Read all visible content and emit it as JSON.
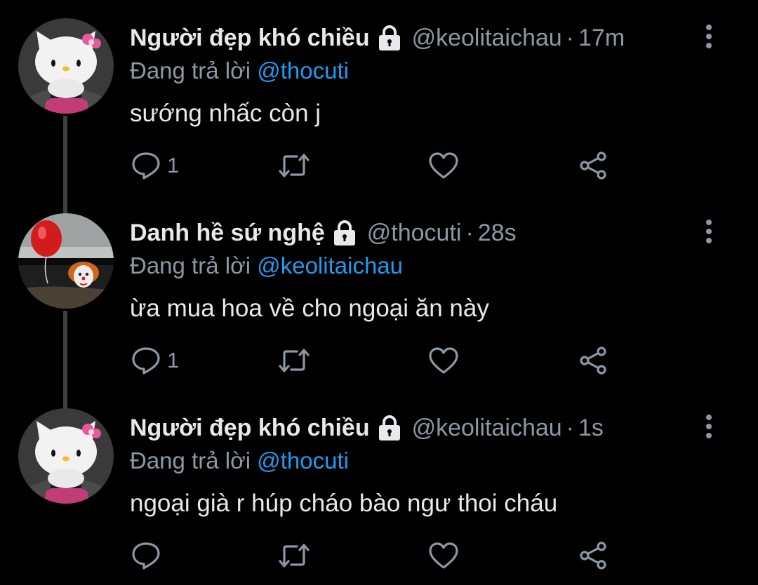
{
  "replying_prefix": "Đang trả lời",
  "tweets": [
    {
      "name": "Người đẹp khó chiều",
      "handle": "@keolitaichau",
      "separator": "·",
      "time": "17m",
      "reply_to": "@thocuti",
      "text": "sướng nhấc còn j",
      "reply_count": "1",
      "avatar": "hello-kitty"
    },
    {
      "name": "Danh hề sứ nghệ",
      "handle": "@thocuti",
      "separator": "·",
      "time": "28s",
      "reply_to": "@keolitaichau",
      "text": "ừa mua hoa về cho ngoại ăn này",
      "reply_count": "1",
      "avatar": "clown-red-balloon"
    },
    {
      "name": "Người đẹp khó chiều",
      "handle": "@keolitaichau",
      "separator": "·",
      "time": "1s",
      "reply_to": "@thocuti",
      "text": "ngoại già r húp cháo bào ngư thoi cháu",
      "reply_count": "",
      "avatar": "hello-kitty"
    }
  ],
  "icons": {
    "lock": "lock-icon",
    "more": "more-vertical-icon",
    "reply": "reply-icon",
    "retweet": "retweet-icon",
    "like": "heart-icon",
    "share": "share-icon"
  },
  "colors": {
    "background": "#000000",
    "text": "#e7e9ea",
    "muted": "#8b98a5",
    "mention": "#1d9bf0",
    "thread_line": "#3a3f44"
  }
}
